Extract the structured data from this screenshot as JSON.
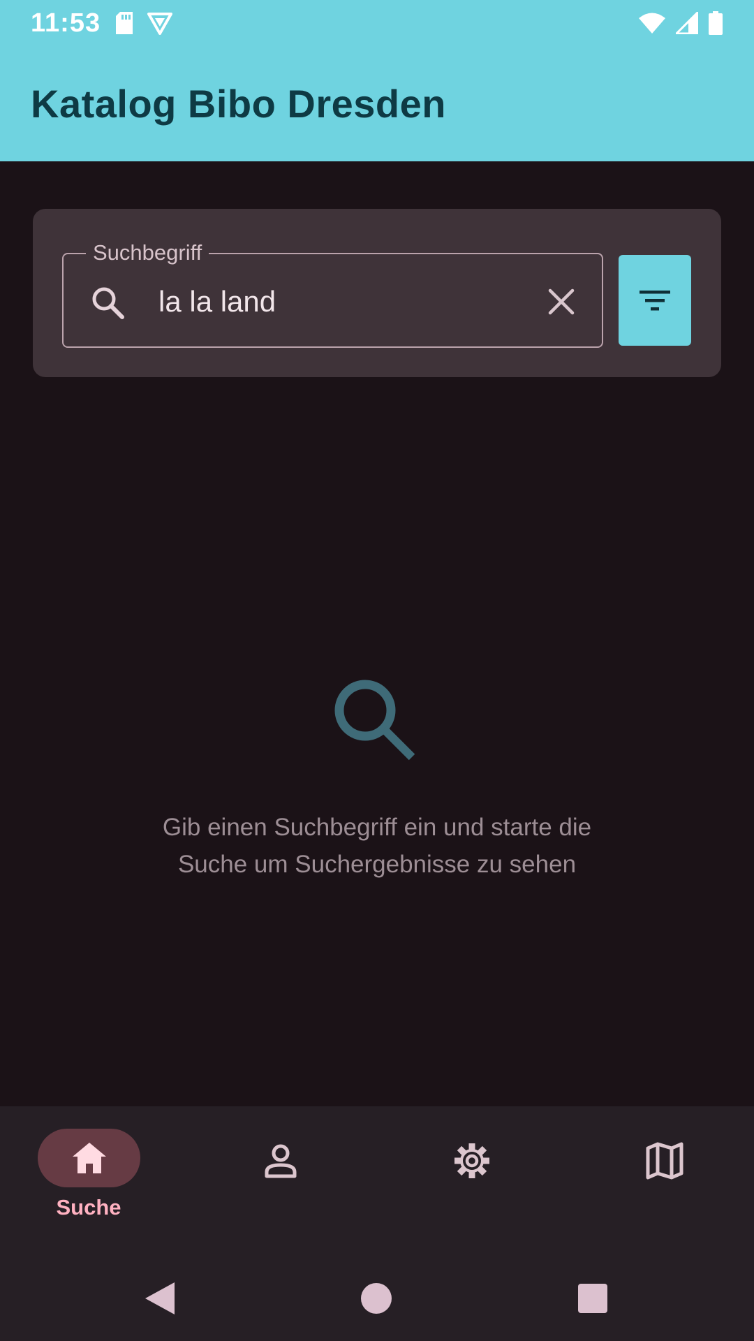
{
  "status_bar": {
    "time": "11:53",
    "icons": [
      "sd-card-icon",
      "vpn-shield-icon",
      "wifi-icon",
      "signal-icon",
      "battery-icon"
    ]
  },
  "app_bar": {
    "title": "Katalog Bibo Dresden"
  },
  "search": {
    "label": "Suchbegriff",
    "value": "la la land",
    "icons": {
      "leading": "search-icon",
      "trailing": "clear-icon",
      "filter": "filter-icon"
    }
  },
  "empty_state": {
    "icon": "search-icon",
    "line1": "Gib einen Suchbegriff ein und starte die",
    "line2": "Suche um Suchergebnisse zu sehen"
  },
  "bottom_nav": {
    "items": [
      {
        "icon": "home-icon",
        "label": "Suche",
        "selected": true
      },
      {
        "icon": "person-icon",
        "label": "",
        "selected": false
      },
      {
        "icon": "gear-icon",
        "label": "",
        "selected": false
      },
      {
        "icon": "map-icon",
        "label": "",
        "selected": false
      }
    ]
  },
  "system_nav": {
    "icons": [
      "back-icon",
      "home-circle-icon",
      "recents-icon"
    ]
  },
  "colors": {
    "accent": "#6fd3e0",
    "background": "#1b1217",
    "card": "#3f3339",
    "nav_background": "#261f25",
    "nav_selected_pill": "#663b44",
    "nav_selected_label": "#ffb1c1",
    "empty_icon": "#3f6b78"
  }
}
